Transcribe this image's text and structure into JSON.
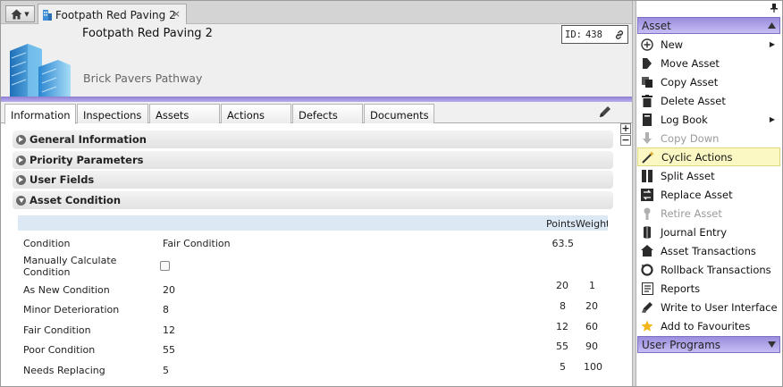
{
  "tab": {
    "title": "Footpath Red Paving 2",
    "close": "×"
  },
  "header": {
    "title": "Footpath Red Paving 2",
    "subtitle": "Brick Pavers Pathway",
    "id_label": "ID:",
    "id_value": "438"
  },
  "tabs": [
    "Information",
    "Inspections",
    "Assets",
    "Actions",
    "Defects",
    "Documents"
  ],
  "sections": [
    "General Information",
    "Priority Parameters",
    "User Fields",
    "Asset Condition"
  ],
  "condition_table": {
    "points_weight_header": "PointsWeight",
    "rows": [
      {
        "label": "Condition",
        "value": "Fair Condition",
        "points": "63.5",
        "weight": ""
      },
      {
        "label": "Manually Calculate Condition",
        "value": "",
        "points": "",
        "weight": ""
      },
      {
        "label": "As New Condition",
        "value": "20",
        "points": "20",
        "weight": "1"
      },
      {
        "label": "Minor Deterioration",
        "value": "8",
        "points": "8",
        "weight": "20"
      },
      {
        "label": "Fair Condition",
        "value": "12",
        "points": "12",
        "weight": "60"
      },
      {
        "label": "Poor Condition",
        "value": "55",
        "points": "55",
        "weight": "90"
      },
      {
        "label": "Needs Replacing",
        "value": "5",
        "points": "5",
        "weight": "100"
      }
    ]
  },
  "menu": {
    "header": "Asset",
    "items": [
      {
        "label": "New",
        "icon": "plus-circle-icon",
        "submenu": true,
        "disabled": false
      },
      {
        "label": "Move Asset",
        "icon": "move-icon",
        "submenu": false,
        "disabled": false
      },
      {
        "label": "Copy Asset",
        "icon": "copy-icon",
        "submenu": false,
        "disabled": false
      },
      {
        "label": "Delete Asset",
        "icon": "trash-icon",
        "submenu": false,
        "disabled": false
      },
      {
        "label": "Log Book",
        "icon": "book-icon",
        "submenu": true,
        "disabled": false
      },
      {
        "label": "Copy Down",
        "icon": "copy-down-icon",
        "submenu": false,
        "disabled": true
      },
      {
        "label": "Cyclic Actions",
        "icon": "wand-icon",
        "submenu": false,
        "disabled": false,
        "highlighted": true
      },
      {
        "label": "Split Asset",
        "icon": "split-icon",
        "submenu": false,
        "disabled": false
      },
      {
        "label": "Replace Asset",
        "icon": "replace-icon",
        "submenu": false,
        "disabled": false
      },
      {
        "label": "Retire Asset",
        "icon": "retire-icon",
        "submenu": false,
        "disabled": true
      },
      {
        "label": "Journal Entry",
        "icon": "journal-icon",
        "submenu": false,
        "disabled": false
      },
      {
        "label": "Asset Transactions",
        "icon": "transactions-icon",
        "submenu": false,
        "disabled": false
      },
      {
        "label": "Rollback Transactions",
        "icon": "rollback-icon",
        "submenu": false,
        "disabled": false
      },
      {
        "label": "Reports",
        "icon": "reports-icon",
        "submenu": false,
        "disabled": false
      },
      {
        "label": "Write to User Interface",
        "icon": "write-icon",
        "submenu": false,
        "disabled": false
      },
      {
        "label": "Add to Favourites",
        "icon": "star-icon",
        "submenu": false,
        "disabled": false
      }
    ],
    "footer_header": "User Programs"
  },
  "colors": {
    "accent_purple": "#9b8ddd",
    "highlight": "#fbf8c4",
    "star": "#f2b51c"
  }
}
